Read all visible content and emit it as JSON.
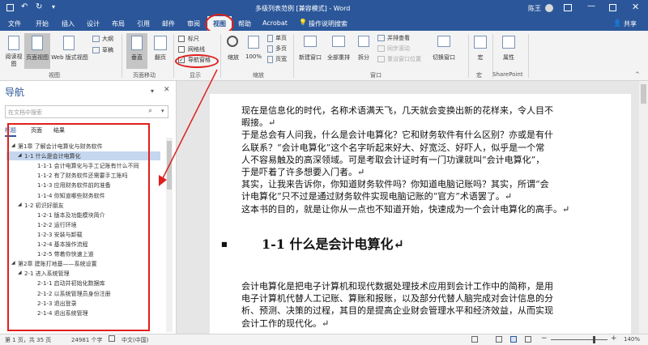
{
  "title": "多级列表范例 [兼容模式] - Word",
  "user": "陈王",
  "share": "共享",
  "tabs": [
    "文件",
    "开始",
    "插入",
    "设计",
    "布局",
    "引用",
    "邮件",
    "审阅",
    "视图",
    "帮助",
    "Acrobat",
    "操作说明搜索"
  ],
  "ribbon": {
    "read_mode": "阅读视图",
    "print_layout": "页面视图",
    "web_layout": "Web 版式视图",
    "outline": "大纲",
    "draft": "草稿",
    "vertical": "垂直",
    "side_to_side": "翻页",
    "ruler": "标尺",
    "gridlines": "网格线",
    "nav_pane": "导航窗格",
    "zoom": "缩放",
    "zoom100": "100%",
    "one_page": "单页",
    "multi_page": "多页",
    "page_width": "页宽",
    "new_window": "新建窗口",
    "arrange_all": "全部重排",
    "split": "拆分",
    "side_by_side": "并排查看",
    "sync_scroll": "同步滚动",
    "reset_window": "重设窗口位置",
    "switch_windows": "切换窗口",
    "macros": "宏",
    "properties": "属性",
    "group_views": "视图",
    "group_page_move": "页面移动",
    "group_show": "显示",
    "group_zoom": "缩放",
    "group_window": "窗口",
    "group_macros": "宏",
    "group_sharepoint": "SharePoint"
  },
  "nav": {
    "title": "导航",
    "search_placeholder": "在文档中搜索",
    "tabs": [
      "标题",
      "页面",
      "结果"
    ],
    "items": [
      {
        "level": 1,
        "text": "第1章 了解会计电算化与财务软件"
      },
      {
        "level": 2,
        "text": "1-1 什么是会计电算化",
        "selected": true
      },
      {
        "level": 3,
        "text": "1-1-1 会计电算化与手工记账有什么不同"
      },
      {
        "level": 3,
        "text": "1-1-2 有了财务软件还需要手工账吗"
      },
      {
        "level": 3,
        "text": "1-1-3 应用财务软件前的准备"
      },
      {
        "level": 3,
        "text": "1-1-4 你知道哪些财务软件"
      },
      {
        "level": 2,
        "text": "1-2 初识好朋友"
      },
      {
        "level": 3,
        "text": "1-2-1 版本及功能模块简介"
      },
      {
        "level": 3,
        "text": "1-2-2 运行环境"
      },
      {
        "level": 3,
        "text": "1-2-3 安装与卸载"
      },
      {
        "level": 3,
        "text": "1-2-4 基本操作流程"
      },
      {
        "level": 3,
        "text": "1-2-5 带着你快速上道"
      },
      {
        "level": 1,
        "text": "第2章 建账打地基——系统设置"
      },
      {
        "level": 2,
        "text": "2-1 进入系统管理"
      },
      {
        "level": 3,
        "text": "2-1-1 启动并初始化数据库"
      },
      {
        "level": 3,
        "text": "2-1-2 以系统管理员身份注册"
      },
      {
        "level": 3,
        "text": "2-1-3 退出登录"
      },
      {
        "level": 3,
        "text": "2-1-4 退出系统管理"
      }
    ]
  },
  "doc": {
    "lines": [
      "现在是信息化的时代，名称术语满天飞，几天就会变换出新的花样来，令人目不",
      "暇接。↵",
      "于是总会有人问我，什么是会计电算化？它和财务软件有什么区别？亦或是有什",
      "么联系？“会计电算化”这个名字听起来好大、好宽泛、好吓人，似乎是一个常",
      "人不容易触及的高深领域。可是考取会计证时有一门功课就叫“会计电算化”，",
      "于是吓着了许多想要入门者。↵",
      "其实，让我来告诉你，你知道财务软件吗？你知道电脑记账吗？其实，所谓“会",
      "计电算化”只不过是通过财务软件实现电脑记账的“官方”术语罢了。↵",
      "这本书的目的，就是让你从一点也不知道开始，快速成为一个会计电算化的高手。↵"
    ],
    "heading": "1-1 什么是会计电算化↵",
    "lines2": [
      "会计电算化是把电子计算机和现代数据处理技术应用到会计工作中的简称，是用",
      "电子计算机代替人工记账、算账和报账，以及部分代替人脑完成对会计信息的分",
      "析、预测、决策的过程，其目的是提高企业财会管理水平和经济效益，从而实现",
      "会计工作的现代化。↵"
    ]
  },
  "status": {
    "page": "第 1 页，共 35 页",
    "words": "24981 个字",
    "lang": "中文(中国)",
    "zoom": "140%"
  },
  "colors": {
    "accent": "#2b579a",
    "highlight": "#e0201c"
  }
}
